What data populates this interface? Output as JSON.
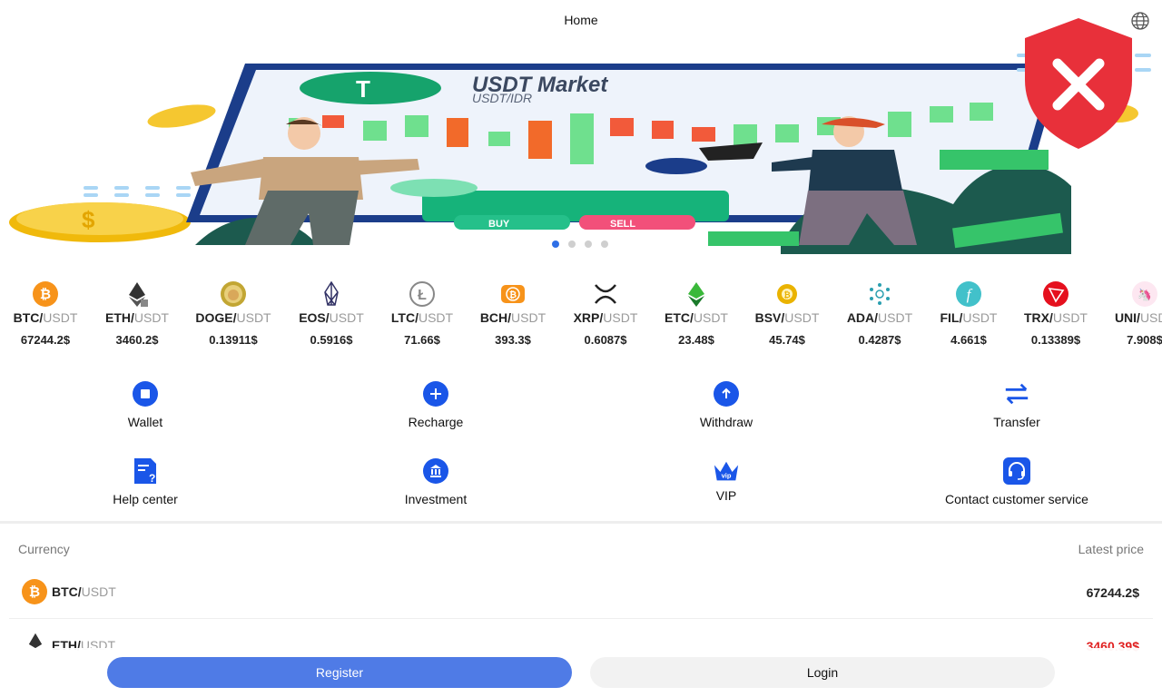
{
  "header": {
    "title": "Home",
    "language_icon": "globe-icon"
  },
  "banner": {
    "headline": "USDT Market",
    "subline": "USDT/IDR",
    "buy_label": "BUY",
    "sell_label": "SELL",
    "slide_count": 4,
    "active_slide": 1
  },
  "overlay": {
    "icon": "shield-x-icon",
    "color": "#e8303a"
  },
  "ticker": [
    {
      "base": "BTC/",
      "quote": "USDT",
      "price": "67244.2$",
      "icon": "bitcoin-icon",
      "color": "#f7931a"
    },
    {
      "base": "ETH/",
      "quote": "USDT",
      "price": "3460.2$",
      "icon": "ethereum-icon",
      "color": "#333333"
    },
    {
      "base": "DOGE/",
      "quote": "USDT",
      "price": "0.13911$",
      "icon": "dogecoin-icon",
      "color": "#c2a633"
    },
    {
      "base": "EOS/",
      "quote": "USDT",
      "price": "0.5916$",
      "icon": "eos-icon",
      "color": "#333366"
    },
    {
      "base": "LTC/",
      "quote": "USDT",
      "price": "71.66$",
      "icon": "litecoin-icon",
      "color": "#888888"
    },
    {
      "base": "BCH/",
      "quote": "USDT",
      "price": "393.3$",
      "icon": "bitcoin-cash-icon",
      "color": "#f7931a"
    },
    {
      "base": "XRP/",
      "quote": "USDT",
      "price": "0.6087$",
      "icon": "xrp-icon",
      "color": "#222222"
    },
    {
      "base": "ETC/",
      "quote": "USDT",
      "price": "23.48$",
      "icon": "ethereum-classic-icon",
      "color": "#3ab83a"
    },
    {
      "base": "BSV/",
      "quote": "USDT",
      "price": "45.74$",
      "icon": "bitcoin-sv-icon",
      "color": "#eab300"
    },
    {
      "base": "ADA/",
      "quote": "USDT",
      "price": "0.4287$",
      "icon": "cardano-icon",
      "color": "#2a9fb0"
    },
    {
      "base": "FIL/",
      "quote": "USDT",
      "price": "4.661$",
      "icon": "filecoin-icon",
      "color": "#42c1ca"
    },
    {
      "base": "TRX/",
      "quote": "USDT",
      "price": "0.13389$",
      "icon": "tron-icon",
      "color": "#e5101e"
    },
    {
      "base": "UNI/",
      "quote": "USDT",
      "price": "7.908$",
      "icon": "uniswap-icon",
      "color": "#ff007a"
    }
  ],
  "actions": [
    {
      "label": "Wallet",
      "icon": "wallet-icon"
    },
    {
      "label": "Recharge",
      "icon": "plus-circle-icon"
    },
    {
      "label": "Withdraw",
      "icon": "arrow-up-circle-icon"
    },
    {
      "label": "Transfer",
      "icon": "transfer-arrows-icon"
    },
    {
      "label": "Help center",
      "icon": "help-document-icon"
    },
    {
      "label": "Investment",
      "icon": "bank-icon"
    },
    {
      "label": "VIP",
      "icon": "vip-crown-icon"
    },
    {
      "label": "Contact customer service",
      "icon": "headset-icon"
    }
  ],
  "market": {
    "currency_header": "Currency",
    "price_header": "Latest price",
    "rows": [
      {
        "base": "BTC/",
        "quote": "USDT",
        "price": "67244.2$",
        "trend": "up"
      },
      {
        "base": "ETH/",
        "quote": "USDT",
        "price": "3460.39$",
        "trend": "down"
      }
    ]
  },
  "buttons": {
    "register": "Register",
    "login": "Login"
  },
  "colors": {
    "accent": "#4f7be6",
    "icon_blue": "#1a56e8",
    "down": "#e02020"
  }
}
